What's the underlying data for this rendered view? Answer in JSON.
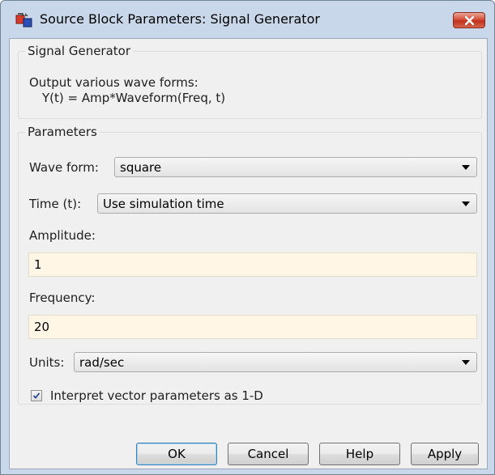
{
  "window": {
    "title": "Source Block Parameters: Signal Generator",
    "icon": "simulink-block-icon",
    "close_icon": "close-icon"
  },
  "description_group": {
    "title": "Signal Generator",
    "line1": "Output various wave forms:",
    "line2": "Y(t) = Amp*Waveform(Freq, t)"
  },
  "parameters": {
    "title": "Parameters",
    "wave_form": {
      "label": "Wave form:",
      "value": "square"
    },
    "time": {
      "label": "Time (t):",
      "value": "Use simulation time"
    },
    "amplitude": {
      "label": "Amplitude:",
      "value": "1"
    },
    "frequency": {
      "label": "Frequency:",
      "value": "20"
    },
    "units": {
      "label": "Units:",
      "value": "rad/sec"
    },
    "interpret_vector": {
      "label": "Interpret vector parameters as 1-D",
      "checked": true
    }
  },
  "buttons": {
    "ok": "OK",
    "cancel": "Cancel",
    "help": "Help",
    "apply": "Apply"
  },
  "colors": {
    "field_bg": "#fff6e6",
    "close_red": "#c0311c",
    "frame": "#c8d8ea"
  }
}
